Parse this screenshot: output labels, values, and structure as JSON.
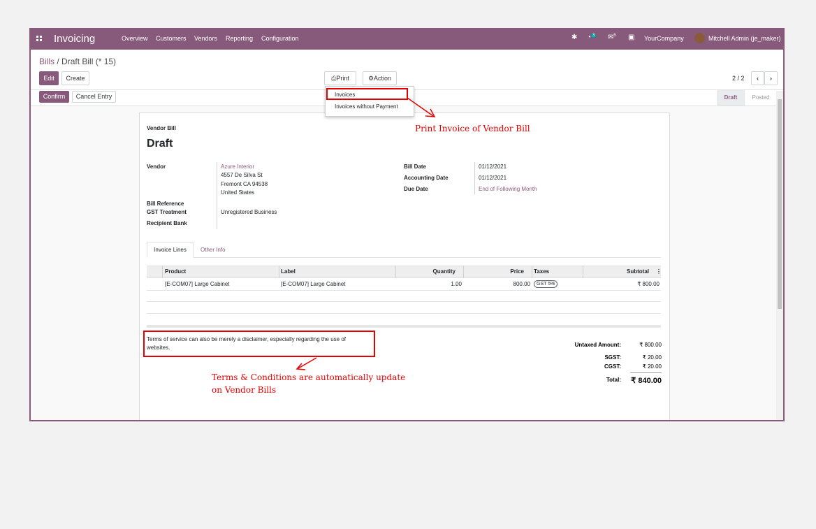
{
  "topbar": {
    "app_name": "Invoicing",
    "menu": [
      "Overview",
      "Customers",
      "Vendors",
      "Reporting",
      "Configuration"
    ],
    "activity_count": "3",
    "message_count": "5",
    "company": "YourCompany",
    "user": "Mitchell Admin (je_maker)"
  },
  "breadcrumb": {
    "parent": "Bills",
    "separator": " / ",
    "current": "Draft Bill (* 15)"
  },
  "buttons": {
    "edit": "Edit",
    "create": "Create",
    "print": "Print",
    "action": "Action",
    "confirm": "Confirm",
    "cancel_entry": "Cancel Entry"
  },
  "pager": {
    "text": "2 / 2"
  },
  "print_menu": [
    "Invoices",
    "Invoices without Payment"
  ],
  "statusbar": {
    "stages": [
      "Draft",
      "Posted"
    ],
    "active": "Draft"
  },
  "sheet": {
    "type_label": "Vendor Bill",
    "status_title": "Draft",
    "vendor_label": "Vendor",
    "vendor_name": "Azure Interior",
    "vendor_address": [
      "4557 De Silva St",
      "Fremont CA 94538",
      "United States"
    ],
    "bill_reference_label": "Bill Reference",
    "gst_treatment_label": "GST Treatment",
    "gst_treatment_value": "Unregistered Business",
    "recipient_bank_label": "Recipient Bank",
    "bill_date_label": "Bill Date",
    "bill_date": "01/12/2021",
    "accounting_date_label": "Accounting Date",
    "accounting_date": "01/12/2021",
    "due_date_label": "Due Date",
    "due_date": "End of Following Month"
  },
  "tabs": [
    "Invoice Lines",
    "Other Info"
  ],
  "table": {
    "headers": [
      "Product",
      "Label",
      "Quantity",
      "Price",
      "Taxes",
      "Subtotal"
    ],
    "rows": [
      {
        "product": "[E-COM07] Large Cabinet",
        "label": "[E-COM07] Large Cabinet",
        "quantity": "1.00",
        "price": "800.00",
        "taxes": "GST 5%",
        "subtotal": "₹ 800.00"
      }
    ]
  },
  "terms": "Terms of service can also be merely a disclaimer, especially regarding the use of websites.",
  "totals": {
    "untaxed_label": "Untaxed Amount:",
    "untaxed": "₹ 800.00",
    "sgst_label": "SGST:",
    "sgst": "₹ 20.00",
    "cgst_label": "CGST:",
    "cgst": "₹ 20.00",
    "total_label": "Total:",
    "total": "₹ 840.00"
  },
  "annotations": {
    "print": "Print Invoice of Vendor Bill",
    "terms_line1": "Terms & Conditions are automatically update",
    "terms_line2": "on Vendor Bills"
  },
  "colors": {
    "brand": "#875a7b",
    "annotation": "#e60000"
  }
}
